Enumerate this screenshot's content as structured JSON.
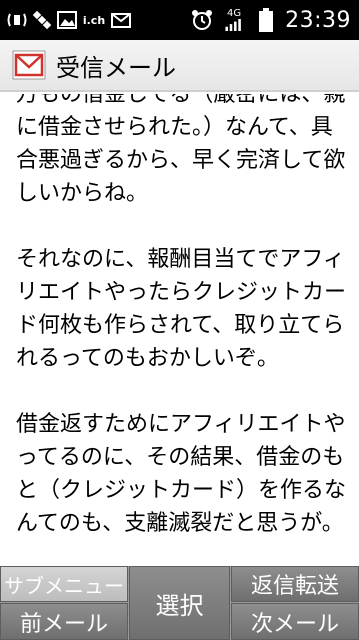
{
  "status_bar": {
    "time": "23:39",
    "network_label": "4G",
    "icons": [
      "signal-wave-icon",
      "satellite-icon",
      "image-icon",
      "ich-icon",
      "mail-notify-icon",
      "alarm-icon",
      "network-4g-icon",
      "battery-icon"
    ],
    "ich_label": "i.ch"
  },
  "title_bar": {
    "title": "受信メール",
    "icon": "mail-envelope-icon"
  },
  "message": {
    "body": "万もの借金してる（厳密には、親に借金させられた。）なんて、具合悪過ぎるから、早く完済して欲しいからね。\n\nそれなのに、報酬目当てでアフィリエイトやったらクレジットカード何枚も作らされて、取り立てられるってのもおかしいぞ。\n\n借金返すためにアフィリエイトやってるのに、その結果、借金のもと（クレジットカード）を作るなんてのも、支離滅裂だと思うが。"
  },
  "softkeys": {
    "sub_menu": "サブメニュー",
    "prev_mail": "前メール",
    "select": "選択",
    "reply_forward": "返信転送",
    "next_mail": "次メール"
  },
  "colors": {
    "status_bg": "#000000",
    "softkey_bg": "#7f7f7f",
    "softkey_light": "#c8c8c8",
    "mail_red": "#d2322d"
  }
}
